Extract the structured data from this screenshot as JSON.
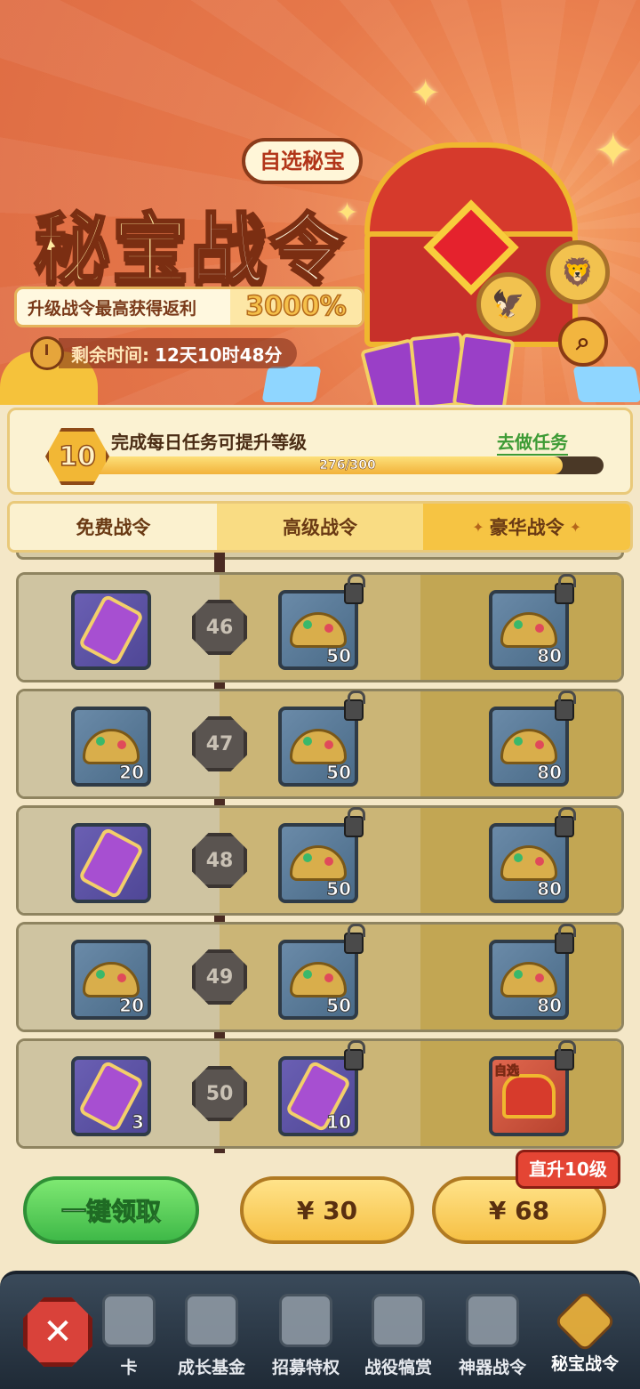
{
  "banner": {
    "bubble": "自选秘宝",
    "title_part1": "秘宝",
    "title_part2": "战令",
    "rebate_label": "升级战令最高获得返利",
    "rebate_value": "3000%",
    "timer_label": "剩余时间:",
    "timer_value": "12天10时48分"
  },
  "progress": {
    "level": "10",
    "task_text": "完成每日任务可提升等级",
    "go_task": "去做任务",
    "current": 276,
    "max": 300,
    "text": "276/300"
  },
  "tabs": [
    "免费战令",
    "高级战令",
    "豪华战令"
  ],
  "rows": [
    {
      "level": "46",
      "free": {
        "type": "jar",
        "qty": ""
      },
      "adv": {
        "type": "gold",
        "qty": "50"
      },
      "lux": {
        "type": "gold",
        "qty": "80"
      }
    },
    {
      "level": "47",
      "free": {
        "type": "gold",
        "qty": "20"
      },
      "adv": {
        "type": "gold",
        "qty": "50"
      },
      "lux": {
        "type": "gold",
        "qty": "80"
      }
    },
    {
      "level": "48",
      "free": {
        "type": "jar",
        "qty": ""
      },
      "adv": {
        "type": "gold",
        "qty": "50"
      },
      "lux": {
        "type": "gold",
        "qty": "80"
      }
    },
    {
      "level": "49",
      "free": {
        "type": "gold",
        "qty": "20"
      },
      "adv": {
        "type": "gold",
        "qty": "50"
      },
      "lux": {
        "type": "gold",
        "qty": "80"
      }
    },
    {
      "level": "50",
      "free": {
        "type": "jar",
        "qty": "3"
      },
      "adv": {
        "type": "jar",
        "qty": "10"
      },
      "lux": {
        "type": "chest",
        "qty": "",
        "tag": "自选"
      }
    }
  ],
  "actions": {
    "claim_all": "一键领取",
    "price_30": "¥ 30",
    "price_68": "¥ 68",
    "jump_badge": "直升10级"
  },
  "nav": {
    "partial_label": "卡",
    "items": [
      "成长基金",
      "招募特权",
      "战役犒赏",
      "神器战令",
      "秘宝战令"
    ],
    "active_index": 4
  }
}
